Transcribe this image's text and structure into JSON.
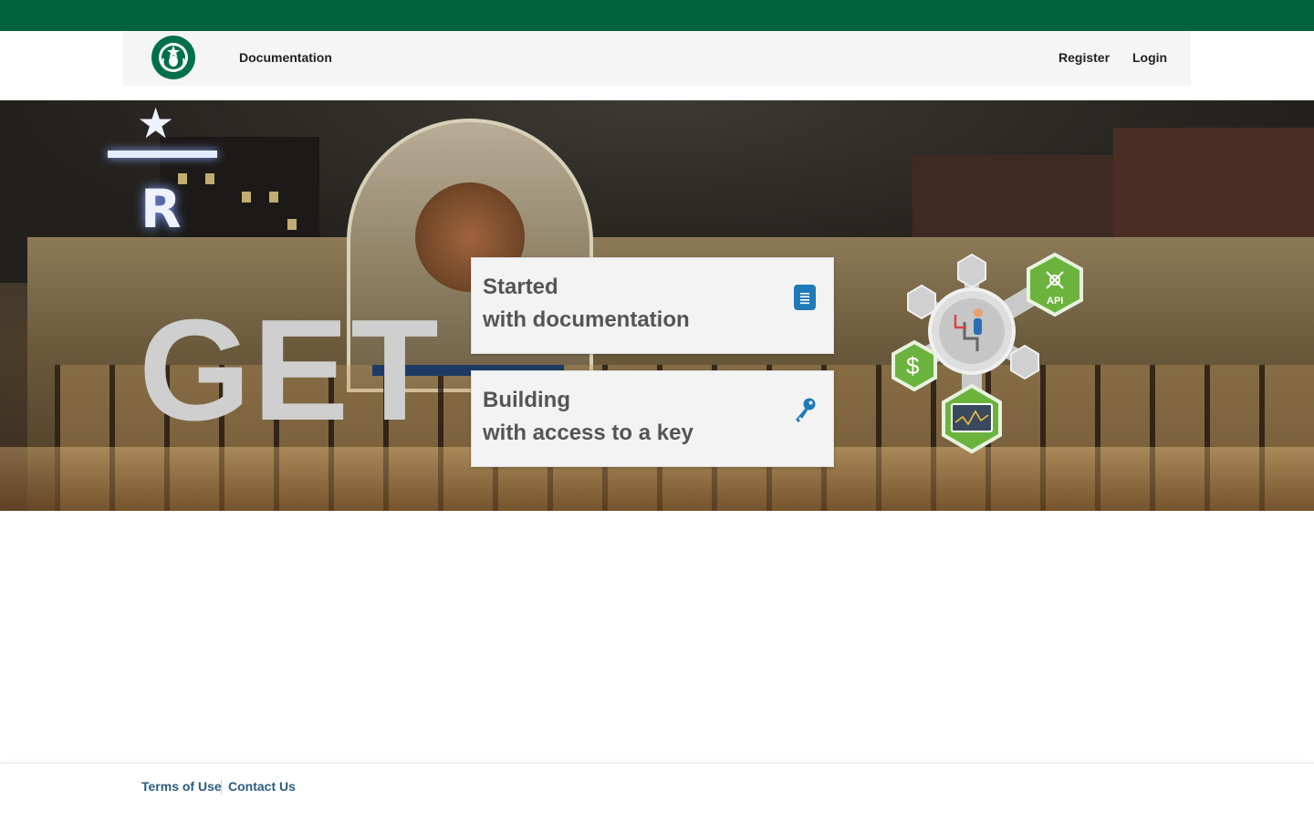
{
  "nav": {
    "logo": "starbucks-logo",
    "documentation_label": "Documentation",
    "register_label": "Register",
    "login_label": "Login"
  },
  "hero": {
    "headline": "GET",
    "cards": [
      {
        "title": "Started",
        "subtitle": "with documentation",
        "icon": "document-icon"
      },
      {
        "title": "Building",
        "subtitle": "with access to a key",
        "icon": "key-icon"
      }
    ],
    "graphic": {
      "icons": [
        "api-icon",
        "dollar-icon",
        "monitor-chart-icon",
        "developer-icon"
      ],
      "api_label": "API",
      "dollar_label": "$"
    },
    "background": {
      "sign_letter": "R",
      "sign_star": "★"
    }
  },
  "footer": {
    "terms_label": "Terms of Use",
    "contact_label": "Contact Us"
  },
  "colors": {
    "brand_green": "#00623f",
    "accent_blue": "#1f7ab8",
    "hex_green": "#6cb33e",
    "footer_link": "#2a5c80"
  }
}
